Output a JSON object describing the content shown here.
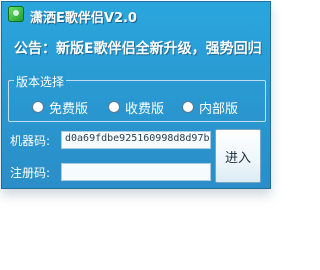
{
  "window": {
    "title": "潇洒E歌伴侣V2.0",
    "icon": "app-logo-icon"
  },
  "notice": "公告：新版E歌伴侣全新升级，强势回归",
  "version_group": {
    "label": "版本选择",
    "options": [
      {
        "label": "免费版",
        "selected": false
      },
      {
        "label": "收费版",
        "selected": false
      },
      {
        "label": "内部版",
        "selected": false
      }
    ]
  },
  "machine_code": {
    "label": "机器码:",
    "value": "d0a69fdbe925160998d8d97b0"
  },
  "register_code": {
    "label": "注册码:",
    "value": ""
  },
  "enter_button": {
    "label": "进入"
  },
  "colors": {
    "window_bg": "#2a98d1",
    "text": "#ffffff"
  }
}
